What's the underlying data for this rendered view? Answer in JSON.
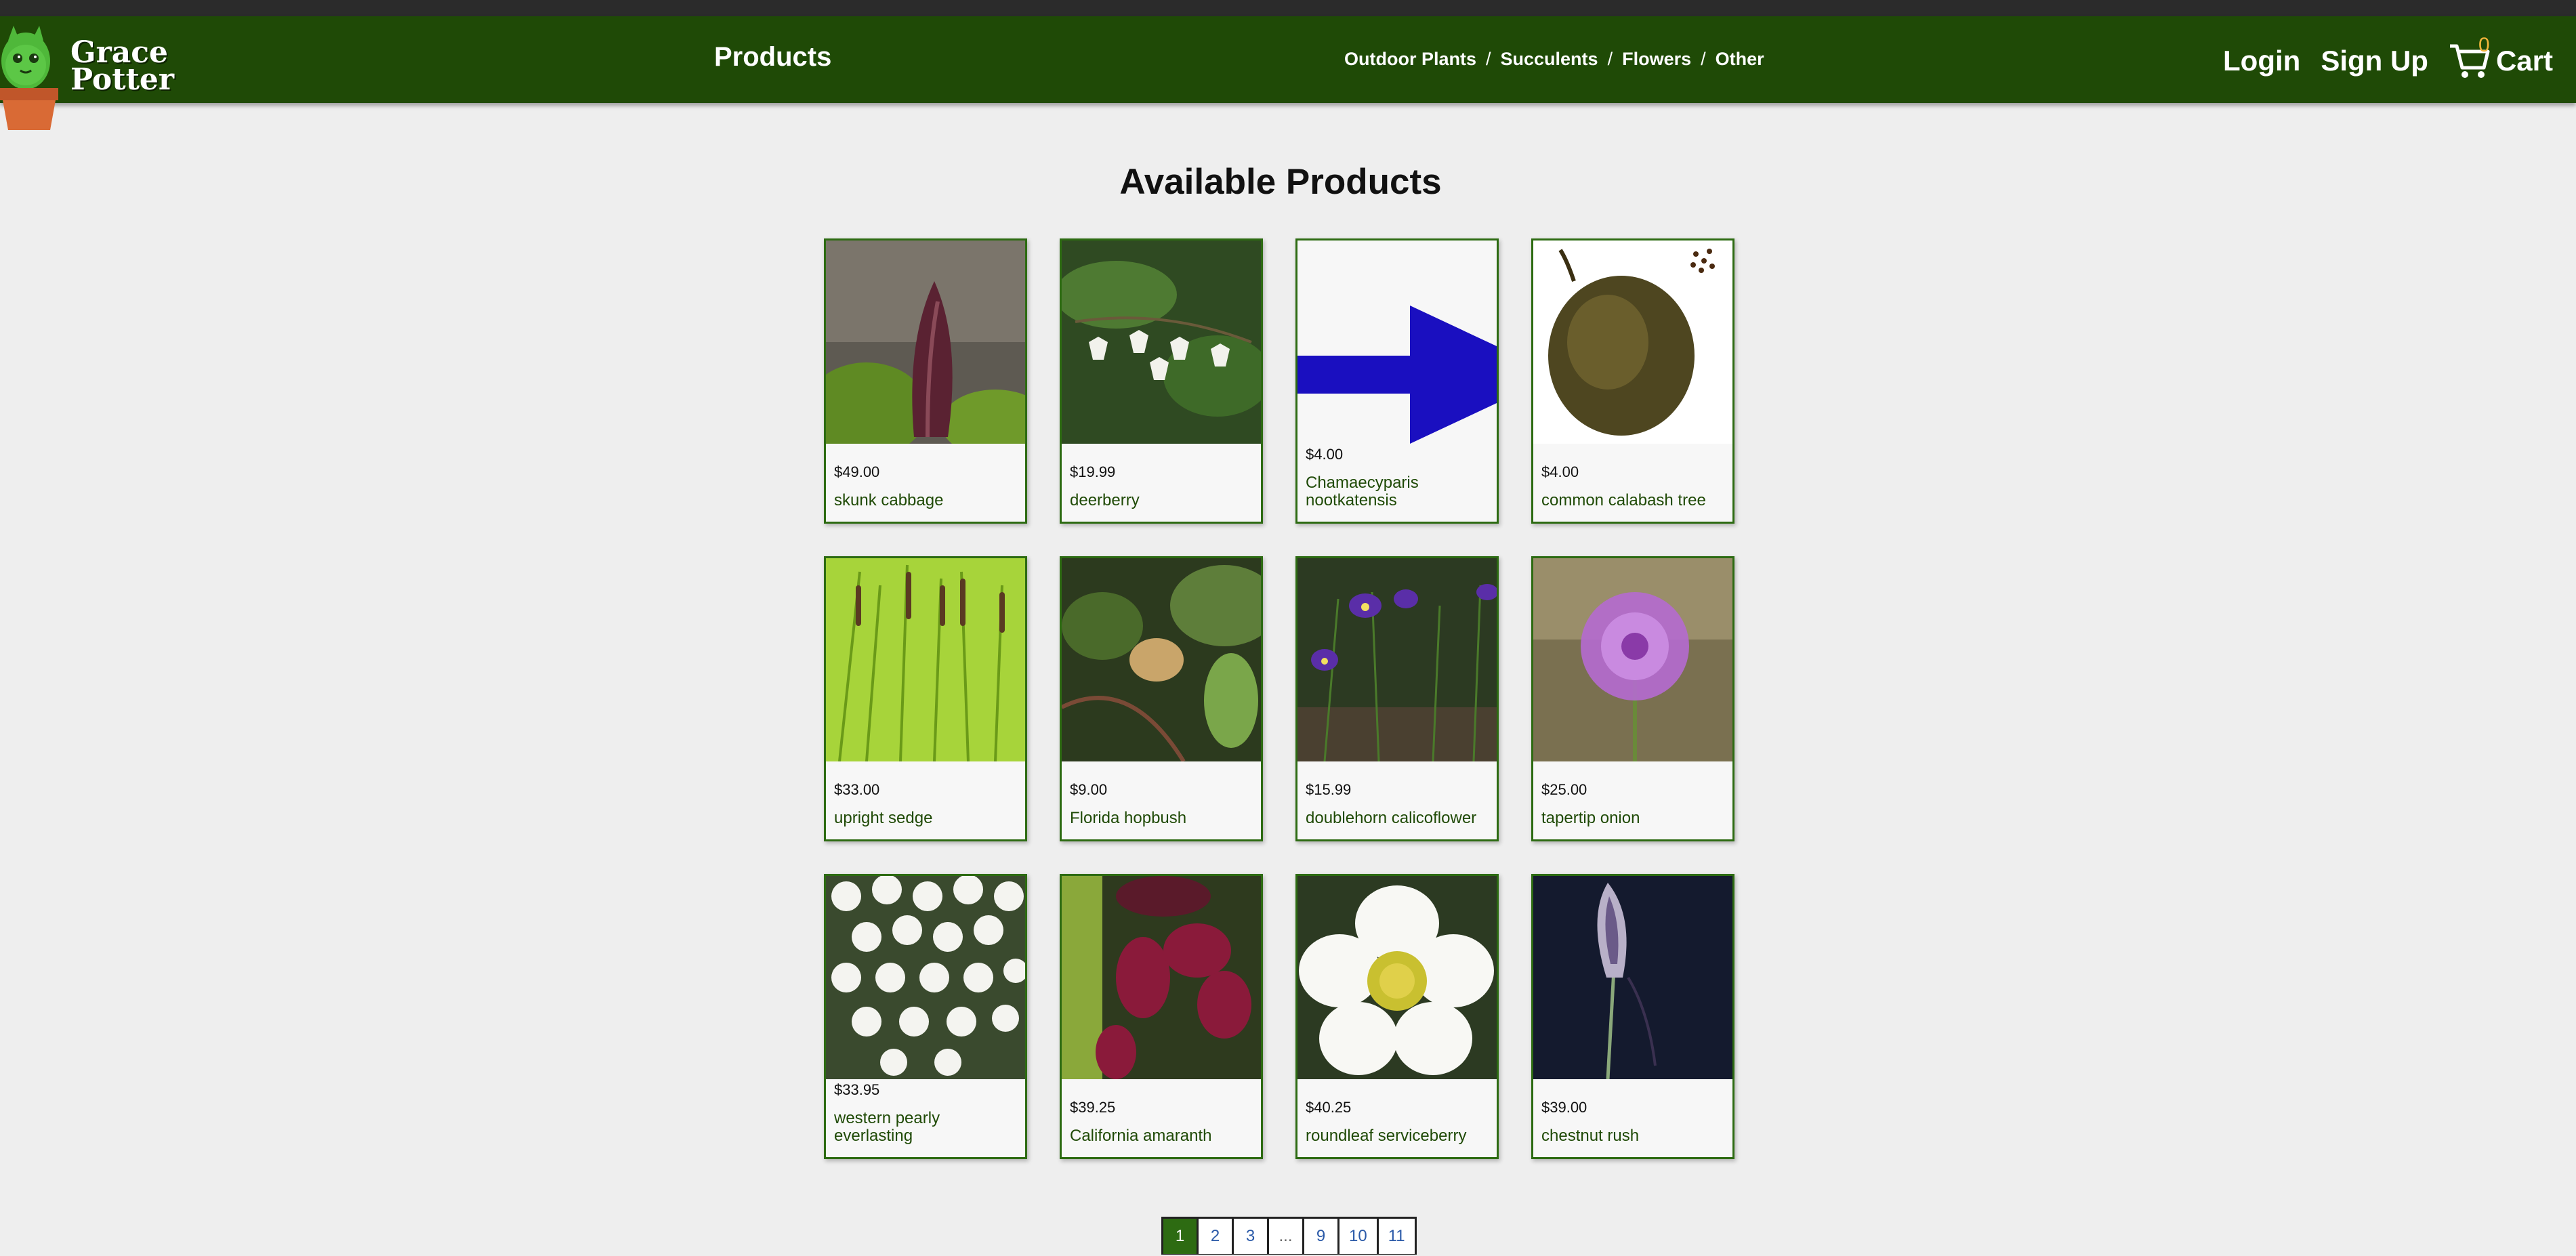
{
  "brand": {
    "name_line1": "Grace",
    "name_line2": "Potter"
  },
  "nav": {
    "products_label": "Products",
    "categories": [
      "Outdoor Plants",
      "Succulents",
      "Flowers",
      "Other"
    ],
    "separator": "/",
    "login_label": "Login",
    "signup_label": "Sign Up",
    "cart_label": "Cart",
    "cart_count": "0"
  },
  "main": {
    "title": "Available Products",
    "products": [
      {
        "price": "$49.00",
        "name": "skunk cabbage"
      },
      {
        "price": "$19.99",
        "name": "deerberry"
      },
      {
        "price": "$4.00",
        "name": "Chamaecyparis nootkatensis"
      },
      {
        "price": "$4.00",
        "name": "common calabash tree"
      },
      {
        "price": "$33.00",
        "name": "upright sedge"
      },
      {
        "price": "$9.00",
        "name": "Florida hopbush"
      },
      {
        "price": "$15.99",
        "name": "doublehorn calicoflower"
      },
      {
        "price": "$25.00",
        "name": "tapertip onion"
      },
      {
        "price": "$33.95",
        "name": "western pearly everlasting"
      },
      {
        "price": "$39.25",
        "name": "California amaranth"
      },
      {
        "price": "$40.25",
        "name": "roundleaf serviceberry"
      },
      {
        "price": "$39.00",
        "name": "chestnut rush"
      }
    ]
  },
  "pagination": {
    "pages": [
      "1",
      "2",
      "3",
      "...",
      "9",
      "10",
      "11"
    ],
    "current": "1"
  },
  "colors": {
    "navbar": "#1f4a06",
    "accent": "#2d6b12",
    "cart_count": "#f3b53a",
    "link": "#2b5aa8"
  }
}
